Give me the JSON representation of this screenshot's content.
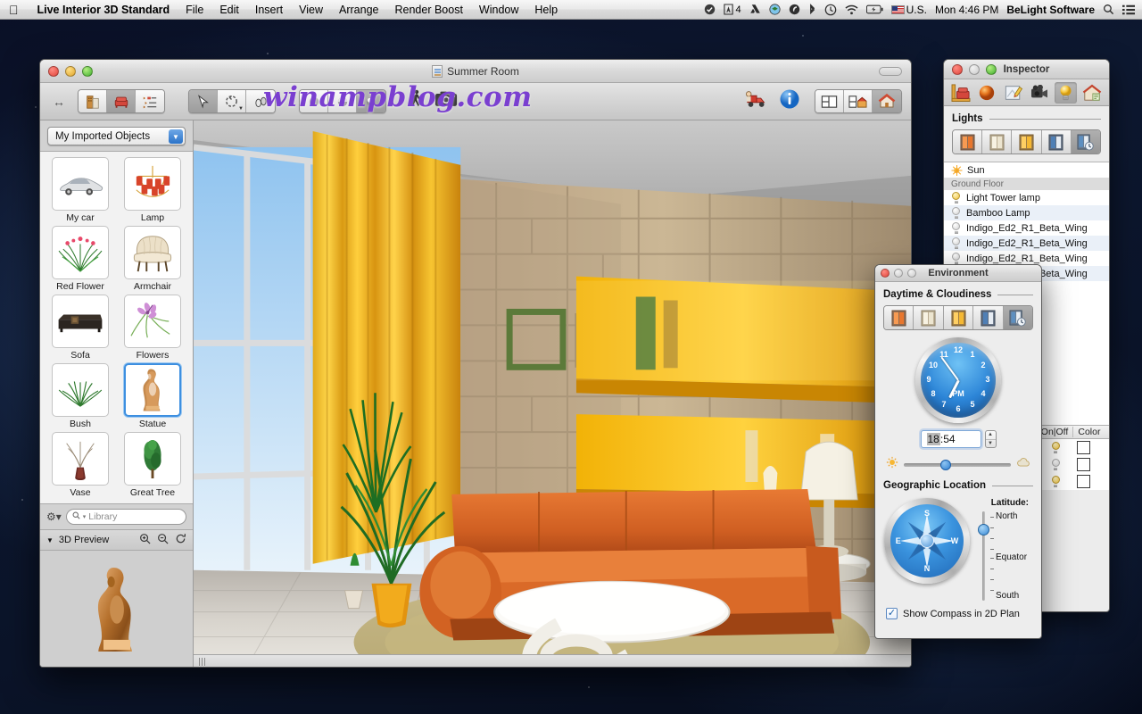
{
  "menubar": {
    "apple_icon": "apple-icon",
    "app_name": "Live Interior 3D Standard",
    "menus": [
      "File",
      "Edit",
      "Insert",
      "View",
      "Arrange",
      "Render Boost",
      "Window",
      "Help"
    ],
    "status_icons": [
      "checkmark-circle-icon",
      "adobe-icon",
      "google-drive-icon",
      "dropbox-icon",
      "evernote-icon",
      "bluetooth-icon",
      "timemachine-icon",
      "wifi-icon",
      "battery-icon"
    ],
    "adobe_badge": "4",
    "input_source": "U.S.",
    "clock": "Mon 4:46 PM",
    "user": "BeLight Software",
    "spotlight_icon": "search-icon",
    "notification_icon": "list-icon"
  },
  "window": {
    "title": "Summer Room",
    "doc_icon": "document-icon",
    "toolbar": {
      "resize_icon": "left-right-arrow-icon",
      "group_view": [
        {
          "name": "building-icon",
          "selected": false
        },
        {
          "name": "furniture-icon",
          "selected": true
        },
        {
          "name": "list-outline-icon",
          "selected": false
        }
      ],
      "group_tools": [
        {
          "name": "arrow-select-icon",
          "selected": true
        },
        {
          "name": "rotate-icon",
          "selected": false
        },
        {
          "name": "walk-pan-icon",
          "selected": false
        }
      ],
      "group_render": [
        {
          "name": "flat-shading-icon",
          "selected": false
        },
        {
          "name": "smooth-shading-icon",
          "selected": false
        },
        {
          "name": "glossy-shading-icon",
          "selected": true
        }
      ],
      "walk_icon": "walkthrough-icon",
      "camera_icon": "camera-icon",
      "watermark": "winampblog.com",
      "truck_icon": "delivery-truck-icon",
      "info_icon": "info-icon",
      "group_layout": [
        {
          "name": "plan-view-icon",
          "selected": false
        },
        {
          "name": "split-view-icon",
          "selected": false
        },
        {
          "name": "3d-view-icon",
          "selected": true
        }
      ]
    }
  },
  "sidebar": {
    "library_popup": {
      "value": "My Imported Objects",
      "chevron_icon": "chevron-down-icon"
    },
    "objects": [
      {
        "label": "My car",
        "icon": "car-icon",
        "selected": false
      },
      {
        "label": "Lamp",
        "icon": "chandelier-icon",
        "selected": false
      },
      {
        "label": "Red Flower",
        "icon": "red-flower-icon",
        "selected": false
      },
      {
        "label": "Armchair",
        "icon": "armchair-icon",
        "selected": false
      },
      {
        "label": "Sofa",
        "icon": "sofa-icon",
        "selected": false
      },
      {
        "label": "Flowers",
        "icon": "flowers-icon",
        "selected": false
      },
      {
        "label": "Bush",
        "icon": "bush-icon",
        "selected": false
      },
      {
        "label": "Statue",
        "icon": "statue-icon",
        "selected": true
      },
      {
        "label": "Vase",
        "icon": "vase-icon",
        "selected": false
      },
      {
        "label": "Great Tree",
        "icon": "tree-icon",
        "selected": false
      }
    ],
    "gear_icon": "gear-icon",
    "search": {
      "placeholder": "Library",
      "value": "",
      "icon": "search-icon"
    },
    "preview": {
      "title": "3D Preview",
      "disclosure_icon": "triangle-down-icon",
      "zoom_in_icon": "zoom-in-icon",
      "zoom_out_icon": "zoom-out-icon",
      "rotate_icon": "rotate-icon"
    }
  },
  "inspector": {
    "title": "Inspector",
    "tabs": [
      {
        "name": "object-tab-icon",
        "selected": false
      },
      {
        "name": "material-tab-icon",
        "selected": false
      },
      {
        "name": "edit-tab-icon",
        "selected": false
      },
      {
        "name": "camera-tab-icon",
        "selected": false
      },
      {
        "name": "light-tab-icon",
        "selected": true
      },
      {
        "name": "site-tab-icon",
        "selected": false
      }
    ],
    "section_title": "Lights",
    "mode_buttons": [
      {
        "name": "light-preset-sunset-icon",
        "selected": false
      },
      {
        "name": "light-preset-day-icon",
        "selected": false
      },
      {
        "name": "light-preset-evening-icon",
        "selected": false
      },
      {
        "name": "light-preset-night-icon",
        "selected": false
      },
      {
        "name": "light-preset-custom-time-icon",
        "selected": true
      }
    ],
    "lights": [
      {
        "label": "Sun",
        "icon": "sun-icon",
        "group": false,
        "on": true
      },
      {
        "label": "Ground Floor",
        "group": true
      },
      {
        "label": "Light Tower lamp",
        "icon": "bulb-on-icon",
        "on": true
      },
      {
        "label": "Bamboo Lamp",
        "icon": "bulb-off-icon",
        "on": false
      },
      {
        "label": "Indigo_Ed2_R1_Beta_Wing",
        "icon": "bulb-off-icon",
        "on": false
      },
      {
        "label": "Indigo_Ed2_R1_Beta_Wing",
        "icon": "bulb-off-icon",
        "on": false
      },
      {
        "label": "Indigo_Ed2_R1_Beta_Wing",
        "icon": "bulb-off-icon",
        "on": false
      },
      {
        "label": "Indigo_Ed2_R1_Beta_Wing",
        "icon": "bulb-off-icon",
        "on": false
      }
    ],
    "table": {
      "columns": [
        "On|Off",
        "Color"
      ],
      "rows": [
        {
          "on": true,
          "color": "#ffffff"
        },
        {
          "on": false,
          "color": "#ffffff"
        },
        {
          "on": true,
          "color": "#ffffff"
        }
      ]
    }
  },
  "environment": {
    "title": "Environment",
    "daytime_section": "Daytime & Cloudiness",
    "preset_buttons": [
      {
        "name": "daytime-sunrise-icon",
        "selected": false
      },
      {
        "name": "daytime-overcast-icon",
        "selected": false
      },
      {
        "name": "daytime-sunny-icon",
        "selected": false
      },
      {
        "name": "daytime-night-icon",
        "selected": false
      },
      {
        "name": "daytime-custom-time-icon",
        "selected": true
      }
    ],
    "clock": {
      "numbers": [
        "12",
        "1",
        "2",
        "3",
        "4",
        "5",
        "6",
        "7",
        "8",
        "9",
        "10",
        "11"
      ],
      "meridiem": "PM",
      "hour": 6,
      "minute": 54
    },
    "time_value": "18:54",
    "time_selected_part": "18",
    "time_separator": ":",
    "time_rest": "54",
    "stepper": {
      "up_icon": "caret-up-icon",
      "down_icon": "caret-down-icon"
    },
    "cloud_slider": {
      "sun_icon": "sun-small-icon",
      "cloud_icon": "cloud-small-icon",
      "value": 34
    },
    "geo_section": "Geographic Location",
    "compass": {
      "directions": [
        "N",
        "E",
        "S",
        "W"
      ],
      "icon": "compass-icon"
    },
    "latitude_label": "Latitude:",
    "latitude_ticks": [
      "North",
      "Equator",
      "South"
    ],
    "latitude_value": 72,
    "show_compass": {
      "label": "Show Compass in 2D Plan",
      "checked": true,
      "check_icon": "checkmark-icon"
    }
  }
}
